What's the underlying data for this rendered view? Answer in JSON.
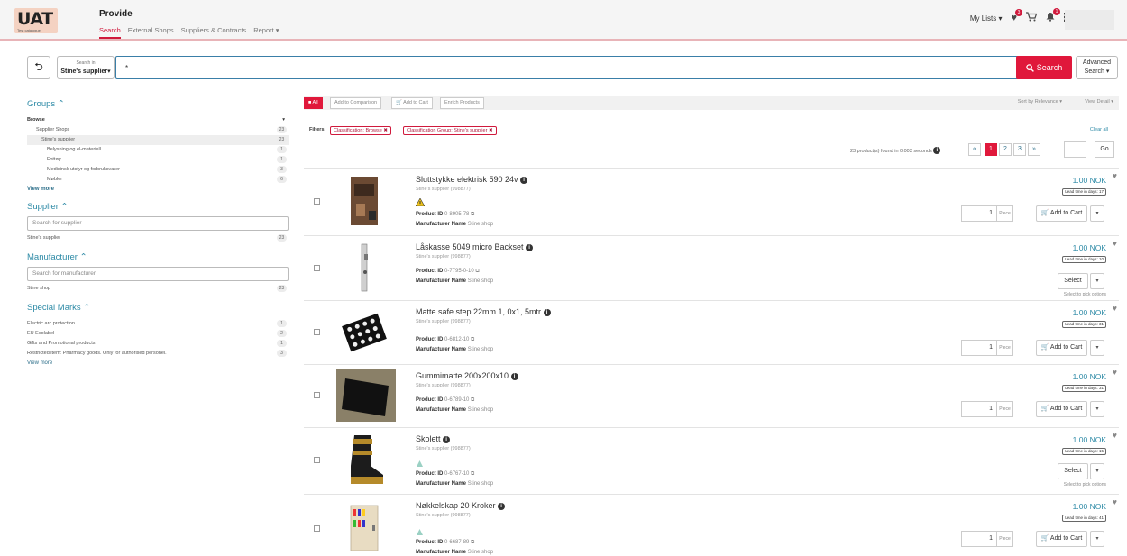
{
  "header": {
    "logo_text": "UAT",
    "logo_sub": "Test catalogue",
    "app_title": "Provide",
    "tabs": [
      {
        "label": "Search"
      },
      {
        "label": "External Shops"
      },
      {
        "label": "Suppliers & Contracts"
      },
      {
        "label": "Report"
      }
    ],
    "my_lists": "My Lists",
    "favorites_badge": "3",
    "notifications_badge": "1"
  },
  "search": {
    "scope_label": "Search in",
    "scope_value": "Stine's supplier",
    "query": "*",
    "button": "Search",
    "advanced_1": "Advanced",
    "advanced_2": "Search"
  },
  "sidebar": {
    "groups": {
      "title": "Groups",
      "browse": "Browse",
      "items": [
        {
          "label": "Supplier Shops",
          "count": "23"
        },
        {
          "label": "Stine's supplier",
          "count": "23"
        },
        {
          "label": "Belysning og el-materiell",
          "count": "1"
        },
        {
          "label": "Fottøy",
          "count": "1"
        },
        {
          "label": "Medisinsk utstyr og forbruksvarer",
          "count": "3"
        },
        {
          "label": "Møbler",
          "count": "6"
        }
      ],
      "view_more": "View more"
    },
    "supplier": {
      "title": "Supplier",
      "placeholder": "Search for supplier",
      "items": [
        {
          "label": "Stine's supplier",
          "count": "23"
        }
      ]
    },
    "manufacturer": {
      "title": "Manufacturer",
      "placeholder": "Search for manufacturer",
      "items": [
        {
          "label": "Stine shop",
          "count": "23"
        }
      ]
    },
    "special_marks": {
      "title": "Special Marks",
      "items": [
        {
          "label": "Electric arc protection",
          "count": "1"
        },
        {
          "label": "EU Ecolabel",
          "count": "2"
        },
        {
          "label": "Gifts and Promotional products",
          "count": "1"
        },
        {
          "label": "Restricted item: Pharmacy goods. Only for authorised personel.",
          "count": "3"
        }
      ],
      "view_more": "View more"
    }
  },
  "toolbar": {
    "all": "All",
    "compare": "Add to Comparison",
    "add_cart": "Add to Cart",
    "enrich": "Enrich Products",
    "sort": "Sort by Relevance",
    "view": "View Detail"
  },
  "filters": {
    "label": "Filters:",
    "chips": [
      "Classification: Browse",
      "Classification Group: Stine's supplier"
    ],
    "clear": "Clear all"
  },
  "results": {
    "summary": "23 product(s) found in 0.003 seconds",
    "pages": [
      "1",
      "2",
      "3"
    ],
    "go": "Go"
  },
  "labels": {
    "product_id": "Product ID",
    "manufacturer_name": "Manufacturer Name",
    "add_to_cart": "Add to Cart",
    "select": "Select",
    "select_hint": "Select to pick options",
    "piece": "Piece"
  },
  "products": [
    {
      "title": "Sluttstykke elektrisk 590 24v",
      "supplier": "Stine's supplier (998877)",
      "product_id": "0-8905-78",
      "manufacturer": "Stine shop",
      "price": "1.00 NOK",
      "lead": "Lead time in days: 17",
      "qty": "1"
    },
    {
      "title": "Låskasse 5049 micro Backset",
      "supplier": "Stine's supplier (998877)",
      "product_id": "0-7795-0-10",
      "manufacturer": "Stine shop",
      "price": "1.00 NOK",
      "lead": "Lead time in days: 10"
    },
    {
      "title": "Matte safe step 22mm 1, 0x1, 5mtr",
      "supplier": "Stine's supplier (998877)",
      "product_id": "0-6812-10",
      "manufacturer": "Stine shop",
      "price": "1.00 NOK",
      "lead": "Lead time in days: 31",
      "qty": "1"
    },
    {
      "title": "Gummimatte 200x200x10",
      "supplier": "Stine's supplier (998877)",
      "product_id": "0-6789-10",
      "manufacturer": "Stine shop",
      "price": "1.00 NOK",
      "lead": "Lead time in days: 31",
      "qty": "1"
    },
    {
      "title": "Skolett",
      "supplier": "Stine's supplier (998877)",
      "product_id": "0-6767-10",
      "manufacturer": "Stine shop",
      "price": "1.00 NOK",
      "lead": "Lead time in days: 15"
    },
    {
      "title": "Nøkkelskap 20 Kroker",
      "supplier": "Stine's supplier (998877)",
      "product_id": "0-6687-89",
      "manufacturer": "Stine shop",
      "price": "1.00 NOK",
      "lead": "Lead time in days: 41",
      "qty": "1"
    }
  ]
}
